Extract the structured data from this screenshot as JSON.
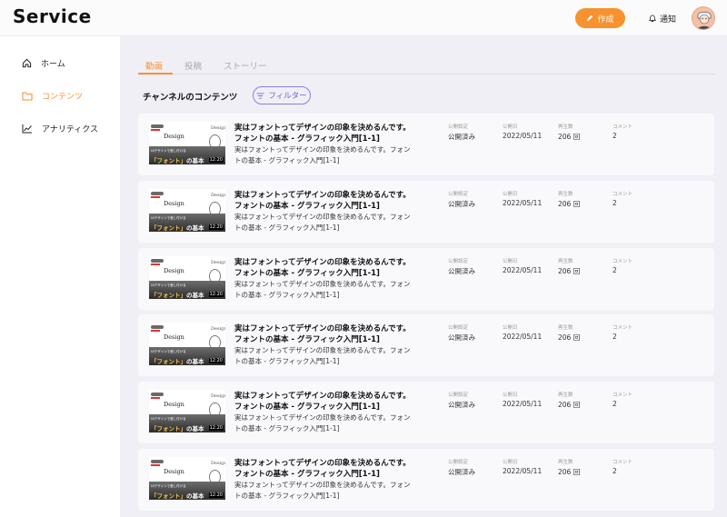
{
  "header": {
    "logo": "Service",
    "create_label": "作成",
    "notify_label": "通知"
  },
  "sidebar": {
    "items": [
      {
        "label": "ホーム",
        "icon": "home-icon",
        "active": false
      },
      {
        "label": "コンテンツ",
        "icon": "folder-icon",
        "active": true
      },
      {
        "label": "アナリティクス",
        "icon": "chart-icon",
        "active": false
      }
    ]
  },
  "tabs": [
    {
      "label": "動画",
      "active": true
    },
    {
      "label": "投稿",
      "active": false
    },
    {
      "label": "ストーリー",
      "active": false
    }
  ],
  "section": {
    "title": "チャンネルのコンテンツ",
    "filter_label": "フィルター"
  },
  "columns": {
    "visibility": "公開設定",
    "date": "公開日",
    "views": "再生数",
    "comments": "コメント"
  },
  "thumbnail": {
    "design": "Design",
    "subtitle": "UIデザインで差し付ける",
    "headline_pre": "「フォント」",
    "headline_post": "の基本",
    "duration": "12:20"
  },
  "rows": [
    {
      "title": "実はフォントってデザインの印象を決めるんです。フォントの基本 - グラフィック入門[1-1]",
      "desc": "実はフォントってデザインの印象を決めるんです。フォントの基本 - グラフィック入門[1-1]",
      "visibility": "公開済み",
      "date": "2022/05/11",
      "views": "206 回",
      "comments": "2"
    },
    {
      "title": "実はフォントってデザインの印象を決めるんです。フォントの基本 - グラフィック入門[1-1]",
      "desc": "実はフォントってデザインの印象を決めるんです。フォントの基本 - グラフィック入門[1-1]",
      "visibility": "公開済み",
      "date": "2022/05/11",
      "views": "206 回",
      "comments": "2"
    },
    {
      "title": "実はフォントってデザインの印象を決めるんです。フォントの基本 - グラフィック入門[1-1]",
      "desc": "実はフォントってデザインの印象を決めるんです。フォントの基本 - グラフィック入門[1-1]",
      "visibility": "公開済み",
      "date": "2022/05/11",
      "views": "206 回",
      "comments": "2"
    },
    {
      "title": "実はフォントってデザインの印象を決めるんです。フォントの基本 - グラフィック入門[1-1]",
      "desc": "実はフォントってデザインの印象を決めるんです。フォントの基本 - グラフィック入門[1-1]",
      "visibility": "公開済み",
      "date": "2022/05/11",
      "views": "206 回",
      "comments": "2"
    },
    {
      "title": "実はフォントってデザインの印象を決めるんです。フォントの基本 - グラフィック入門[1-1]",
      "desc": "実はフォントってデザインの印象を決めるんです。フォントの基本 - グラフィック入門[1-1]",
      "visibility": "公開済み",
      "date": "2022/05/11",
      "views": "206 回",
      "comments": "2"
    },
    {
      "title": "実はフォントってデザインの印象を決めるんです。フォントの基本 - グラフィック入門[1-1]",
      "desc": "実はフォントってデザインの印象を決めるんです。フォントの基本 - グラフィック入門[1-1]",
      "visibility": "公開済み",
      "date": "2022/05/11",
      "views": "206 回",
      "comments": "2"
    }
  ],
  "colors": {
    "accent": "#f7922e",
    "filter": "#6c5ed8",
    "background": "#f0eff6"
  }
}
